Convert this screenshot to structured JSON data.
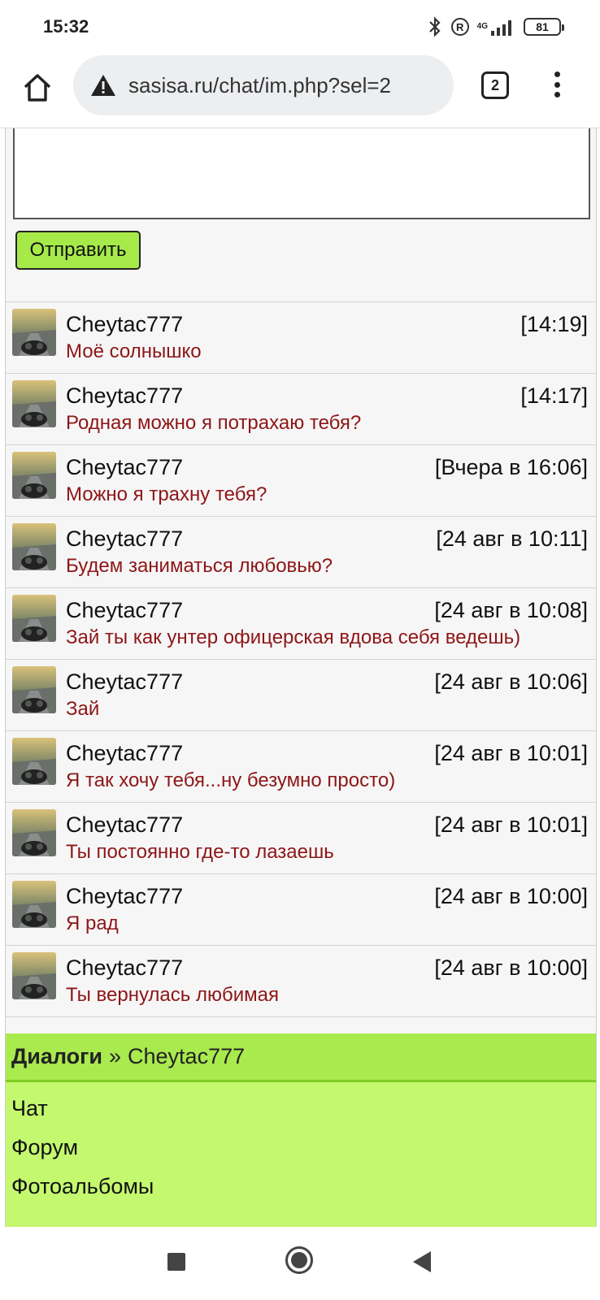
{
  "status_bar": {
    "time": "15:32",
    "network": "4G",
    "battery": "81",
    "icons": [
      "bluetooth-icon",
      "registered-icon",
      "signal-icon",
      "battery-icon"
    ]
  },
  "browser": {
    "url": "sasisa.ru/chat/im.php?sel=2",
    "tab_count": "2",
    "icons": [
      "home-icon",
      "warning-icon",
      "tabs-icon",
      "more-icon"
    ]
  },
  "compose": {
    "message_value": "",
    "send_label": "Отправить"
  },
  "messages": [
    {
      "author": "Cheytac777",
      "time": "[14:19]",
      "text": "Моё солнышко"
    },
    {
      "author": "Cheytac777",
      "time": "[14:17]",
      "text": "Родная можно я потрахаю тебя?"
    },
    {
      "author": "Cheytac777",
      "time": "[Вчера в 16:06]",
      "text": "Можно я трахну тебя?"
    },
    {
      "author": "Cheytac777",
      "time": "[24 авг в 10:11]",
      "text": "Будем заниматься любовью?"
    },
    {
      "author": "Cheytac777",
      "time": "[24 авг в 10:08]",
      "text": "Зай ты как унтер офицерская вдова себя ведешь)"
    },
    {
      "author": "Cheytac777",
      "time": "[24 авг в 10:06]",
      "text": "Зай"
    },
    {
      "author": "Cheytac777",
      "time": "[24 авг в 10:01]",
      "text": "Я так хочу тебя...ну безумно просто)"
    },
    {
      "author": "Cheytac777",
      "time": "[24 авг в 10:01]",
      "text": "Ты постоянно где-то лазаешь"
    },
    {
      "author": "Cheytac777",
      "time": "[24 авг в 10:00]",
      "text": "Я рад"
    },
    {
      "author": "Cheytac777",
      "time": "[24 авг в 10:00]",
      "text": "Ты вернулась любимая"
    }
  ],
  "breadcrumb": {
    "root": "Диалоги",
    "separator": "»",
    "current": "Cheytac777"
  },
  "nav_links": [
    "Чат",
    "Форум",
    "Фотоальбомы"
  ],
  "colors": {
    "accent_green": "#a9ea4e",
    "nav_green": "#c4f86e",
    "message_text": "#8e1616"
  }
}
